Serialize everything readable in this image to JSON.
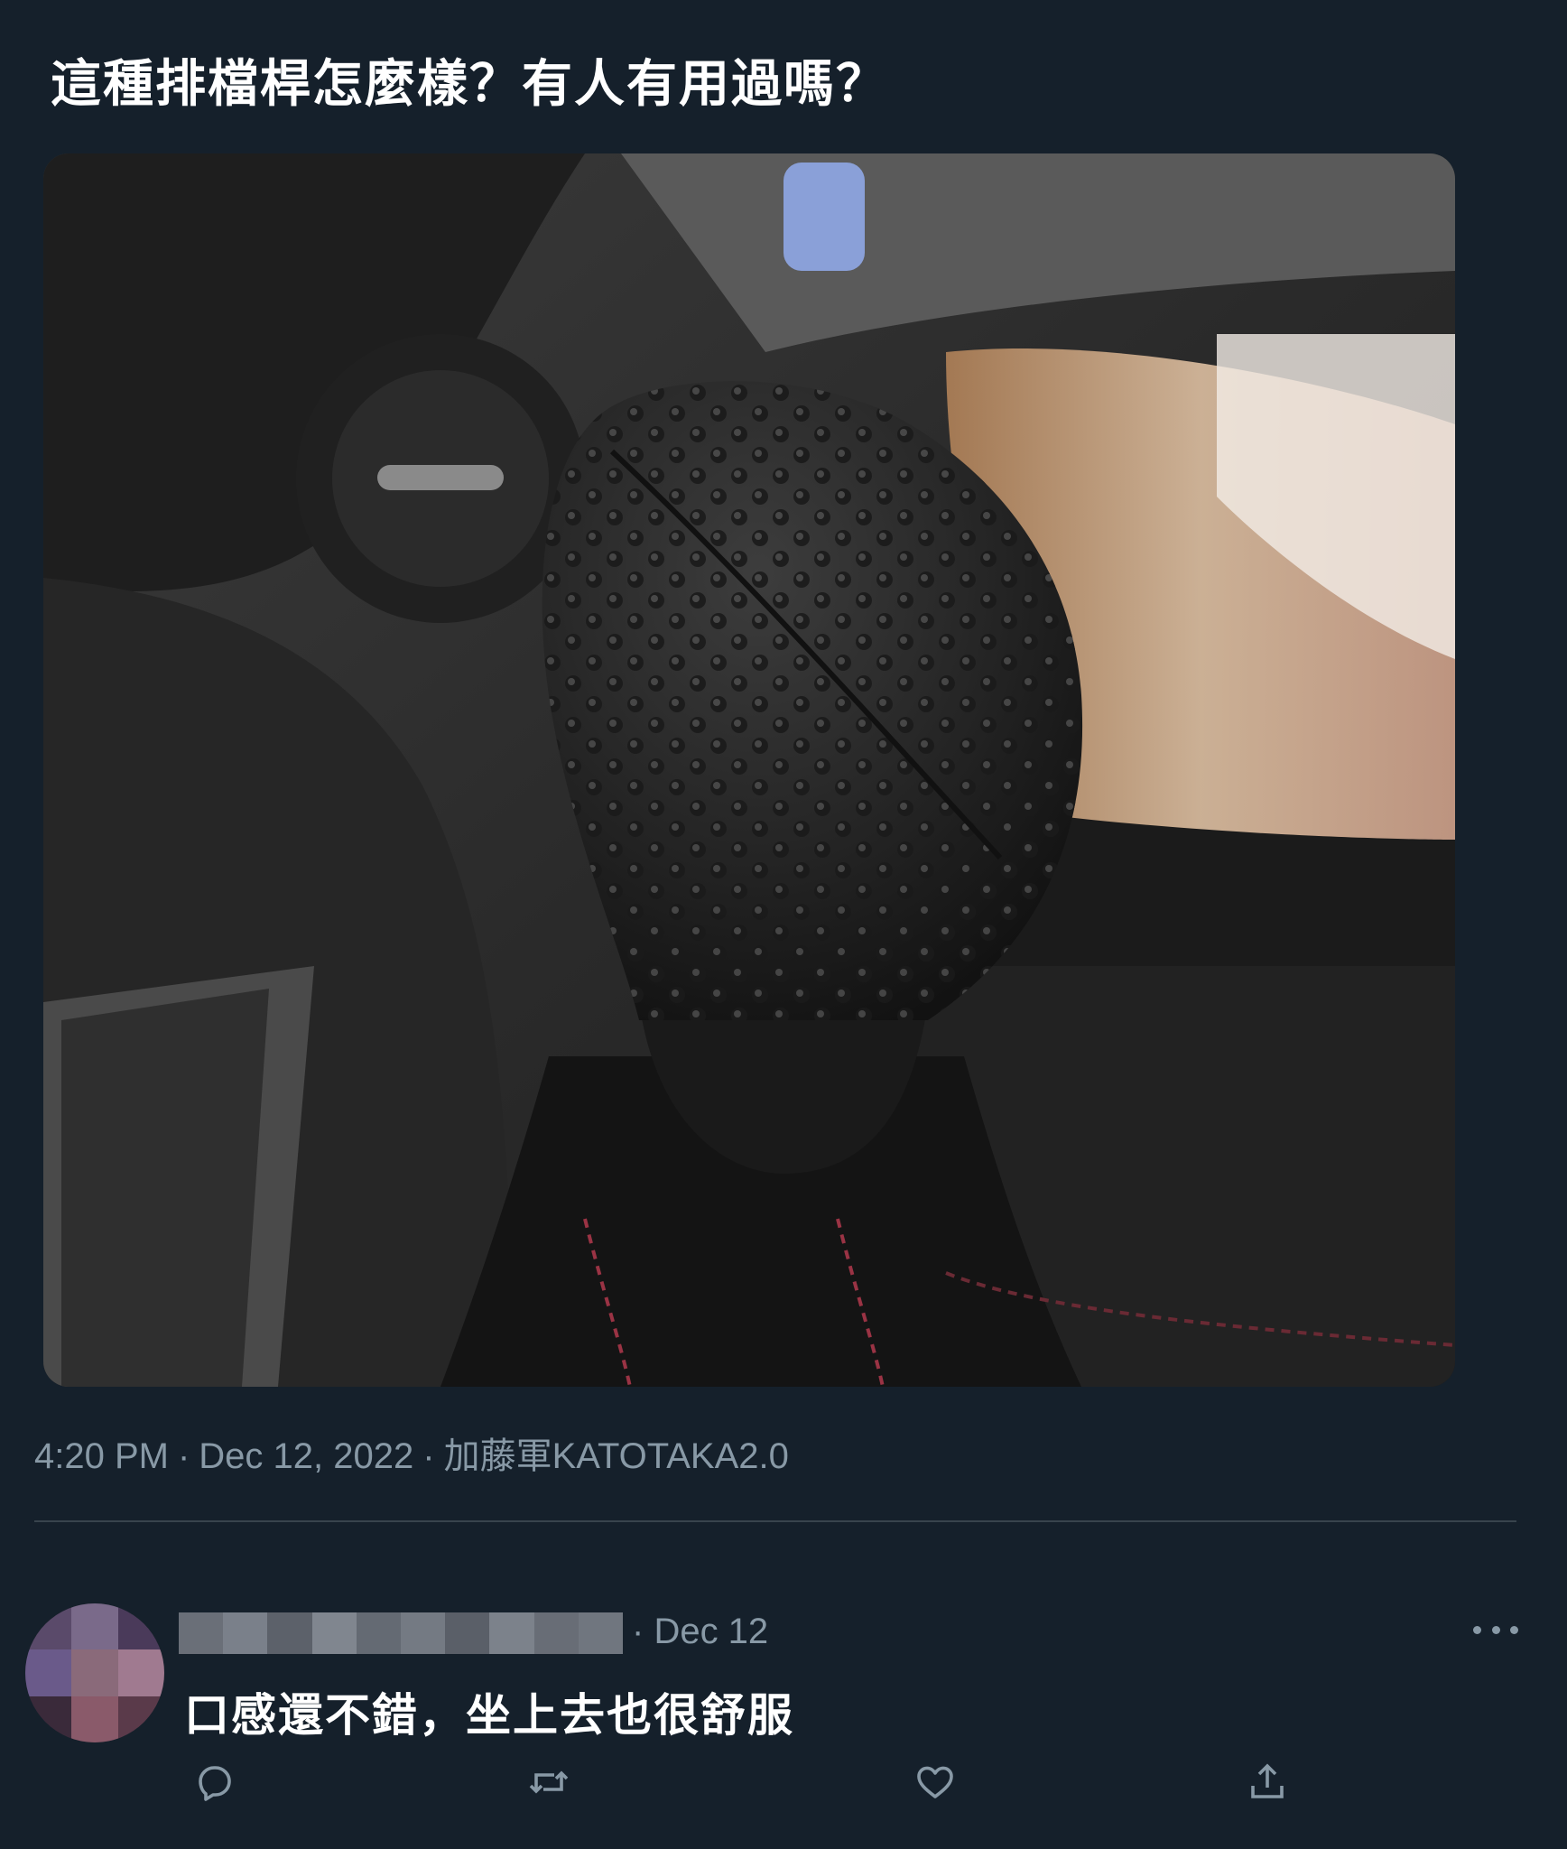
{
  "tweet": {
    "text": "這種排檔桿怎麼樣？有人有用過嗎？",
    "media_icon": "gear-shift-knob-photo"
  },
  "meta": {
    "time": "4:20 PM",
    "date": "Dec 12, 2022",
    "source": "加藤軍KATOTAKA2.0"
  },
  "reply": {
    "date": "Dec 12",
    "text": "口感還不錯，坐上去也很舒服",
    "author_name": "",
    "more_icon": "more-icon"
  },
  "actions": [
    {
      "name": "reply",
      "icon": "reply-icon"
    },
    {
      "name": "retweet",
      "icon": "retweet-icon"
    },
    {
      "name": "like",
      "icon": "heart-icon"
    },
    {
      "name": "share",
      "icon": "share-icon"
    }
  ],
  "colors": {
    "background": "#15202b",
    "secondary_text": "#8899a6",
    "divider": "#38444d",
    "text": "#ffffff"
  }
}
